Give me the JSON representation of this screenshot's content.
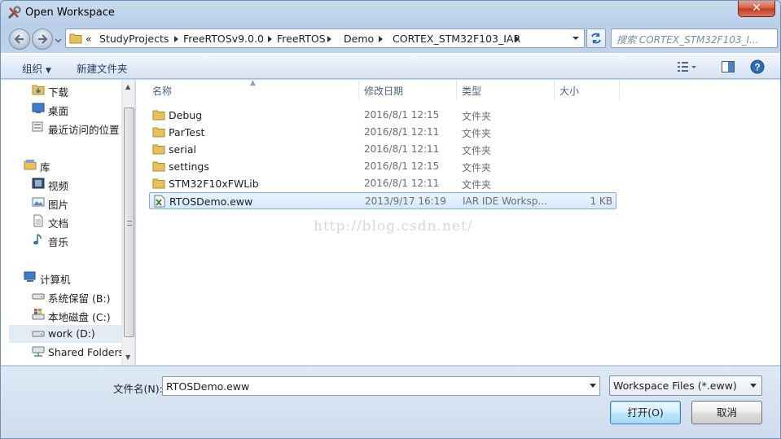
{
  "window": {
    "title": "Open Workspace",
    "close_label": "✕"
  },
  "address": {
    "overflow": "«",
    "crumbs": [
      "StudyProjects",
      "FreeRTOSv9.0.0",
      "FreeRTOS",
      "Demo",
      "CORTEX_STM32F103_IAR"
    ],
    "search_placeholder": "搜索 CORTEX_STM32F103_I..."
  },
  "toolbar": {
    "organize": "组织",
    "new_folder": "新建文件夹"
  },
  "nav": {
    "favorites": [
      {
        "label": "下载",
        "icon": "download-folder-icon"
      },
      {
        "label": "桌面",
        "icon": "desktop-icon"
      },
      {
        "label": "最近访问的位置",
        "icon": "recent-places-icon"
      }
    ],
    "libraries_label": "库",
    "libraries": [
      {
        "label": "视频",
        "icon": "video-library-icon"
      },
      {
        "label": "图片",
        "icon": "picture-library-icon"
      },
      {
        "label": "文档",
        "icon": "document-library-icon"
      },
      {
        "label": "音乐",
        "icon": "music-library-icon"
      }
    ],
    "computer_label": "计算机",
    "drives": [
      {
        "label": "系统保留 (B:)",
        "icon": "drive-icon"
      },
      {
        "label": "本地磁盘 (C:)",
        "icon": "system-drive-icon"
      },
      {
        "label": "work (D:)",
        "icon": "drive-icon"
      },
      {
        "label": "Shared Folders",
        "icon": "network-drive-icon"
      }
    ]
  },
  "columns": {
    "name": "名称",
    "date": "修改日期",
    "type": "类型",
    "size": "大小"
  },
  "files": [
    {
      "name": "Debug",
      "date": "2016/8/1 12:15",
      "type": "文件夹",
      "size": "",
      "icon": "folder-icon"
    },
    {
      "name": "ParTest",
      "date": "2016/8/1 12:11",
      "type": "文件夹",
      "size": "",
      "icon": "folder-icon"
    },
    {
      "name": "serial",
      "date": "2016/8/1 12:11",
      "type": "文件夹",
      "size": "",
      "icon": "folder-icon"
    },
    {
      "name": "settings",
      "date": "2016/8/1 12:15",
      "type": "文件夹",
      "size": "",
      "icon": "folder-icon"
    },
    {
      "name": "STM32F10xFWLib",
      "date": "2016/8/1 12:11",
      "type": "文件夹",
      "size": "",
      "icon": "folder-icon"
    },
    {
      "name": "RTOSDemo.eww",
      "date": "2013/9/17 16:19",
      "type": "IAR IDE Worksp...",
      "size": "1 KB",
      "icon": "eww-file-icon"
    }
  ],
  "watermark": "http://blog.csdn.net/",
  "bottom": {
    "filename_label": "文件名(N):",
    "filename_value": "RTOSDemo.eww",
    "filter_value": "Workspace Files (*.eww)",
    "open_label": "打开(O)",
    "cancel_label": "取消"
  },
  "colors": {
    "folder": "#e8c15a",
    "selection": "#d6e8fb",
    "selection_border": "#84acdd"
  }
}
